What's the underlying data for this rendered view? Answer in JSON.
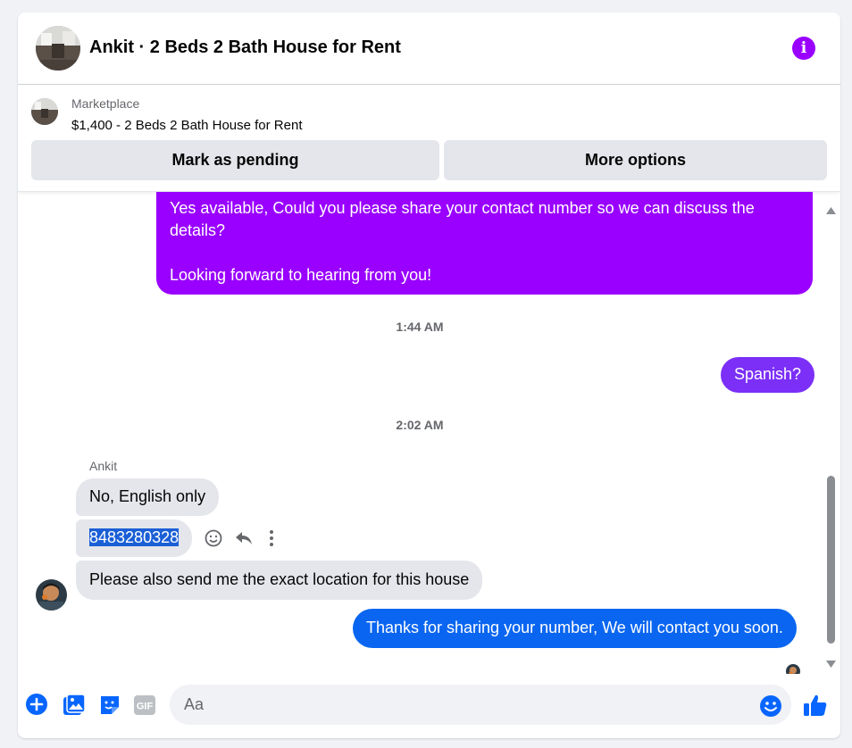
{
  "header": {
    "title": "Ankit · 2 Beds 2 Bath House for Rent",
    "accent": "#9900ff"
  },
  "listing": {
    "source": "Marketplace",
    "title": "$1,400 - 2 Beds 2 Bath House for Rent",
    "mark_pending_label": "Mark as pending",
    "more_options_label": "More options"
  },
  "messages": {
    "msg1": {
      "line1": "Yes available, Could you please share your contact number so we can discuss the",
      "line2": "details?",
      "line3": "Looking forward to hearing from you!"
    },
    "time1": "1:44 AM",
    "msg2": "Spanish?",
    "time2": "2:02 AM",
    "sender": "Ankit",
    "msg3": "No, English only",
    "msg4": "8483280328",
    "msg5": "Please also send me the exact location for this house",
    "msg6": "Thanks for sharing your number, We will contact you soon."
  },
  "composer": {
    "placeholder": "Aa",
    "icons": [
      "plus-icon",
      "photo-icon",
      "sticker-icon",
      "gif-icon",
      "emoji-icon",
      "thumbs-up-icon"
    ],
    "gif_label": "GIF"
  },
  "colors": {
    "bubble_purple": "#9900ff",
    "bubble_violet": "#7b2ff7",
    "bubble_blue": "#0a66f0",
    "bubble_gray": "#e4e6eb",
    "messenger_blue": "#0866ff"
  }
}
